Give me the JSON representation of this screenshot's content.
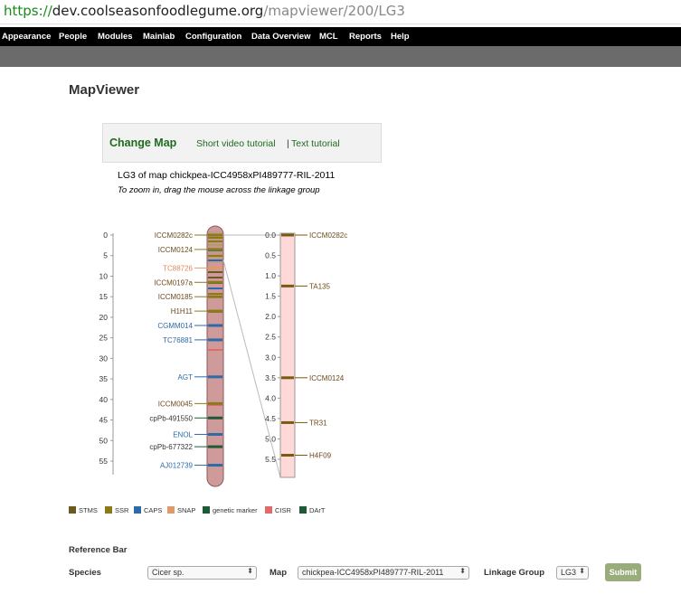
{
  "browser": {
    "url_scheme": "https://",
    "url_host": "dev.coolseasonfoodlegume.org",
    "url_path": "/mapviewer/200/LG3"
  },
  "nav": {
    "items": [
      "Appearance",
      "People",
      "Modules",
      "Mainlab",
      "Configuration",
      "Data Overview",
      "MCL",
      "Reports",
      "Help"
    ]
  },
  "page": {
    "title": "MapViewer"
  },
  "change_map": {
    "label": "Change Map",
    "video": "Short video tutorial",
    "sep": "|",
    "text": "Text tutorial"
  },
  "map": {
    "title": "LG3 of map chickpea-ICC4958xPI489777-RIL-2011",
    "hint": "To zoom in, drag the mouse across the linkage group",
    "left_axis": [
      "0",
      "5",
      "10",
      "15",
      "20",
      "25",
      "30",
      "35",
      "40",
      "45",
      "50",
      "55"
    ],
    "right_axis": [
      "0.0",
      "0.5",
      "1.0",
      "1.5",
      "2.0",
      "2.5",
      "3.0",
      "3.5",
      "4.0",
      "4.5",
      "5.0",
      "5.5"
    ],
    "left_markers": [
      {
        "label": "ICCM0282c",
        "pos": 0,
        "type": "SSR"
      },
      {
        "label": "ICCM0124",
        "pos": 3.5,
        "type": "SSR"
      },
      {
        "label": "TC88726",
        "pos": 8,
        "type": "SNAP"
      },
      {
        "label": "ICCM0197a",
        "pos": 11.5,
        "type": "SSR"
      },
      {
        "label": "ICCM0185",
        "pos": 15,
        "type": "SSR"
      },
      {
        "label": "H1H11",
        "pos": 18.5,
        "type": "SSR"
      },
      {
        "label": "CGMM014",
        "pos": 22,
        "type": "CAPS"
      },
      {
        "label": "TC76881",
        "pos": 25.5,
        "type": "CAPS"
      },
      {
        "label": "AGT",
        "pos": 34.5,
        "type": "CAPS"
      },
      {
        "label": "ICCM0045",
        "pos": 41,
        "type": "SSR"
      },
      {
        "label": "cpPb-491550",
        "pos": 44.5,
        "type": "genetic marker"
      },
      {
        "label": "ENOL",
        "pos": 48.5,
        "type": "CAPS"
      },
      {
        "label": "cpPb-677322",
        "pos": 51.5,
        "type": "genetic marker"
      },
      {
        "label": "AJ012739",
        "pos": 56,
        "type": "CAPS"
      }
    ],
    "right_markers": [
      {
        "label": "ICCM0282c",
        "pos": 0.0
      },
      {
        "label": "TA135",
        "pos": 1.25
      },
      {
        "label": "ICCM0124",
        "pos": 3.5
      },
      {
        "label": "TR31",
        "pos": 4.6
      },
      {
        "label": "H4F09",
        "pos": 5.4
      }
    ]
  },
  "legend": [
    {
      "label": "STMS",
      "color": "#6b5a1e"
    },
    {
      "label": "SSR",
      "color": "#8a7a1a"
    },
    {
      "label": "CAPS",
      "color": "#2d6aa8"
    },
    {
      "label": "SNAP",
      "color": "#e09a6a"
    },
    {
      "label": "genetic marker",
      "color": "#1f5a36"
    },
    {
      "label": "CISR",
      "color": "#e36a6a"
    },
    {
      "label": "DArT",
      "color": "#1f5a36"
    }
  ],
  "reference": {
    "title": "Reference Bar",
    "species_label": "Species",
    "species_value": "Cicer sp.",
    "map_label": "Map",
    "map_value": "chickpea-ICC4958xPI489777-RIL-2011",
    "lg_label": "Linkage Group",
    "lg_value": "LG3",
    "submit": "Submit"
  }
}
